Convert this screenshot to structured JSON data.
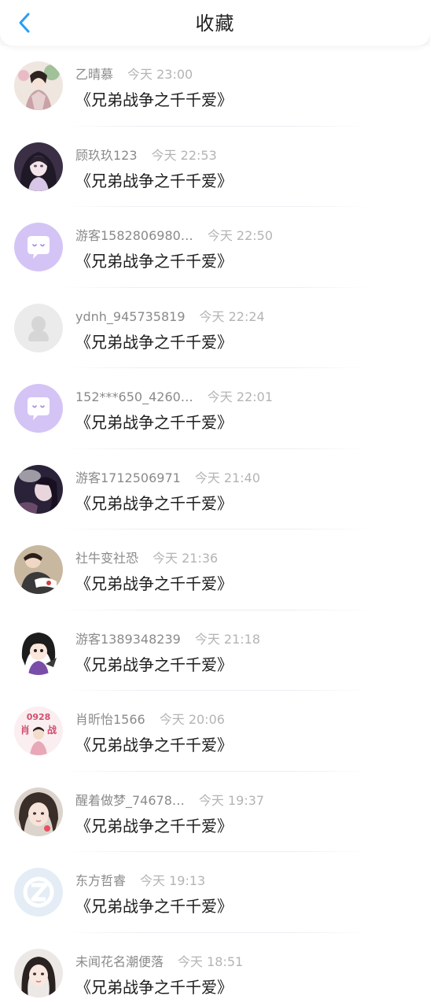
{
  "header": {
    "title": "收藏",
    "back_icon": "chevron-left-icon",
    "accent_color": "#2b9df4"
  },
  "items": [
    {
      "user": "乙晴慕",
      "time": "今天 23:00",
      "book": "《兄弟战争之千千爱》",
      "avatar": "photo-avatar"
    },
    {
      "user": "顾玖玖123",
      "time": "今天 22:53",
      "book": "《兄弟战争之千千爱》",
      "avatar": "photo-avatar"
    },
    {
      "user": "游客1582806980…",
      "time": "今天 22:50",
      "book": "《兄弟战争之千千爱》",
      "avatar": "default-chat-avatar"
    },
    {
      "user": "ydnh_945735819",
      "time": "今天 22:24",
      "book": "《兄弟战争之千千爱》",
      "avatar": "default-grey-avatar"
    },
    {
      "user": "152***650_4260…",
      "time": "今天 22:01",
      "book": "《兄弟战争之千千爱》",
      "avatar": "default-chat-avatar"
    },
    {
      "user": "游客1712506971",
      "time": "今天 21:40",
      "book": "《兄弟战争之千千爱》",
      "avatar": "photo-avatar"
    },
    {
      "user": "社牛变社恐",
      "time": "今天 21:36",
      "book": "《兄弟战争之千千爱》",
      "avatar": "photo-avatar"
    },
    {
      "user": "游客1389348239",
      "time": "今天 21:18",
      "book": "《兄弟战争之千千爱》",
      "avatar": "photo-avatar"
    },
    {
      "user": "肖昕怡1566",
      "time": "今天 20:06",
      "book": "《兄弟战争之千千爱》",
      "avatar": "photo-avatar",
      "avatar_text": [
        "0928",
        "肖",
        "战"
      ]
    },
    {
      "user": "醒着做梦_74678…",
      "time": "今天 19:37",
      "book": "《兄弟战争之千千爱》",
      "avatar": "photo-avatar"
    },
    {
      "user": "东方哲睿",
      "time": "今天 19:13",
      "book": "《兄弟战争之千千爱》",
      "avatar": "default-z-avatar"
    },
    {
      "user": "未闻花名潮便落",
      "time": "今天 18:51",
      "book": "《兄弟战争之千千爱》",
      "avatar": "photo-avatar"
    }
  ]
}
